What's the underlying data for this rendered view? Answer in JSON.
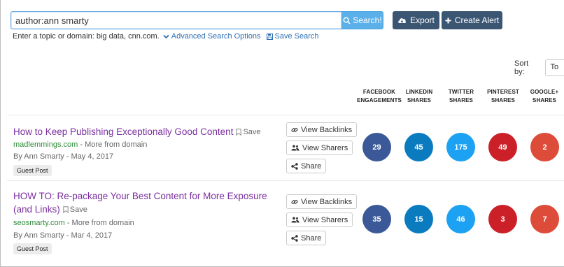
{
  "search": {
    "query": "author:ann smarty",
    "button_label": "Search!",
    "export_label": "Export",
    "create_alert_label": "Create Alert",
    "hint": "Enter a topic or domain: big data, cnn.com.",
    "advanced_label": "Advanced Search Options",
    "save_search_label": "Save Search"
  },
  "sort": {
    "label": "Sort by:",
    "selected": "To"
  },
  "columns": [
    {
      "line1": "FACEBOOK",
      "line2": "ENGAGEMENTS"
    },
    {
      "line1": "LINKEDIN",
      "line2": "SHARES"
    },
    {
      "line1": "TWITTER",
      "line2": "SHARES"
    },
    {
      "line1": "PINTEREST",
      "line2": "SHARES"
    },
    {
      "line1": "GOOGLE+",
      "line2": "SHARES"
    }
  ],
  "actions": {
    "backlinks": "View Backlinks",
    "sharers": "View Sharers",
    "share": "Share"
  },
  "save_label": "Save",
  "more_from_domain": " - More from domain",
  "colors": {
    "facebook": "#3b5998",
    "linkedin": "#0a7bbf",
    "twitter": "#1da1f2",
    "pinterest": "#cb2027",
    "googleplus": "#dd4b39"
  },
  "results": [
    {
      "title": "How to Keep Publishing Exceptionally Good Content",
      "domain": "madlemmings.com",
      "byline": "By Ann Smarty - May 4, 2017",
      "badge": "Guest Post",
      "metrics": [
        "29",
        "45",
        "175",
        "49",
        "2"
      ]
    },
    {
      "title_line1": "HOW TO: Re-package Your Best Content for More Exposure",
      "title_line2": "(and Links)",
      "domain": "seosmarty.com",
      "byline": "By Ann Smarty - Mar 4, 2017",
      "badge": "Guest Post",
      "metrics": [
        "35",
        "15",
        "46",
        "3",
        "7"
      ]
    }
  ]
}
